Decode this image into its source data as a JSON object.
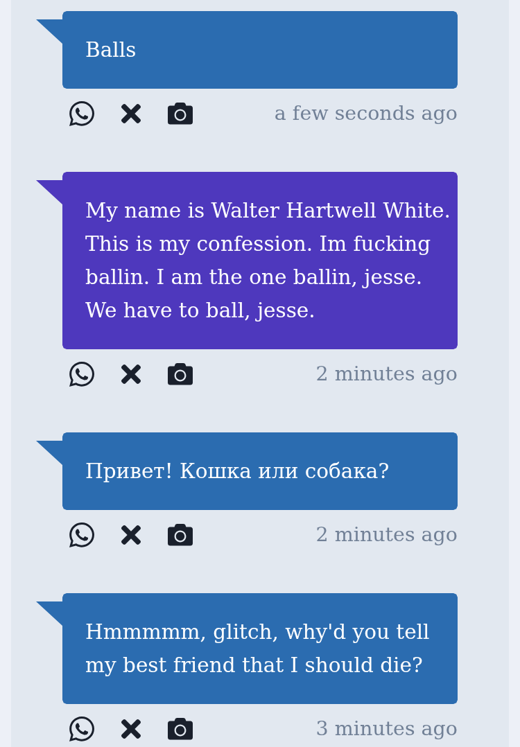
{
  "messages": [
    {
      "text": "Balls",
      "color": "#2b6cb0",
      "time": "a few seconds ago"
    },
    {
      "text": "My name is Walter Hartwell White. This is my confession. Im fucking ballin. I am the one ballin, jesse. We have to ball, jesse.",
      "color": "#4e38bd",
      "time": "2 minutes ago"
    },
    {
      "text": "Привет! Кошка или собака?",
      "color": "#2b6cb0",
      "time": "2 minutes ago"
    },
    {
      "text": "Hmmmmm, glitch, why'd you tell my best friend that I should die?",
      "color": "#2b6cb0",
      "time": "3 minutes ago"
    }
  ]
}
